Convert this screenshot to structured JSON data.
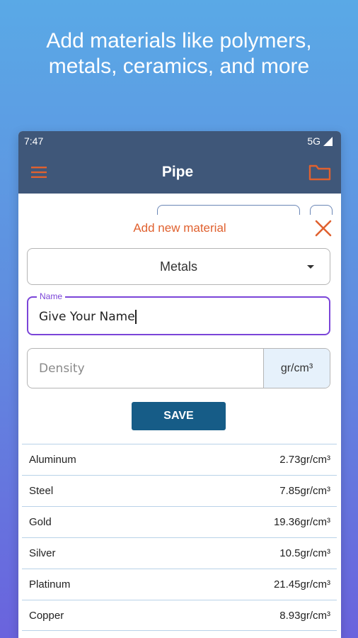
{
  "headline": {
    "line1": "Add materials like polymers,",
    "line2": "metals, ceramics, and more"
  },
  "status_bar": {
    "time": "7:47",
    "network": "5G"
  },
  "app_bar": {
    "title": "Pipe",
    "menu_icon": "menu-icon",
    "folder_icon": "folder-icon",
    "accent_color": "#e0612f"
  },
  "dialog": {
    "title": "Add new material",
    "close_icon": "close-icon",
    "category_select": {
      "value": "Metals"
    },
    "name_field": {
      "label": "Name",
      "value": "Give Your Name"
    },
    "density_field": {
      "placeholder": "Density",
      "unit": "gr/cm³"
    },
    "save_label": "SAVE"
  },
  "materials": [
    {
      "name": "Aluminum",
      "density": "2.73gr/cm³"
    },
    {
      "name": "Steel",
      "density": "7.85gr/cm³"
    },
    {
      "name": "Gold",
      "density": "19.36gr/cm³"
    },
    {
      "name": "Silver",
      "density": "10.5gr/cm³"
    },
    {
      "name": "Platinum",
      "density": "21.45gr/cm³"
    },
    {
      "name": "Copper",
      "density": "8.93gr/cm³"
    }
  ],
  "colors": {
    "appbar": "#3f5779",
    "primary_button": "#165c87",
    "focus": "#7b45d8"
  }
}
